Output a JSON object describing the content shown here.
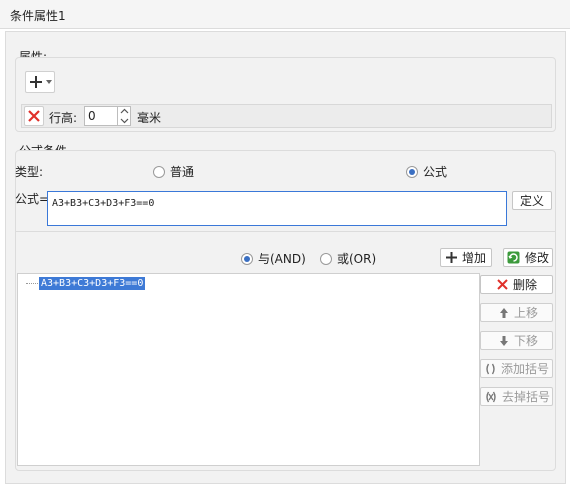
{
  "window": {
    "title": "条件属性1"
  },
  "properties": {
    "section_label": "属性:",
    "add_icon": "plus-icon",
    "row_height_label": "行高:",
    "row_height_value": "0",
    "row_height_unit": "毫米"
  },
  "formula_section": {
    "section_label": "公式条件",
    "type_label": "类型:",
    "type_options": [
      "普通",
      "公式"
    ],
    "type_selected": "公式",
    "formula_label": "公式=",
    "formula_value": "A3+B3+C3+D3+F3==0",
    "define_button": "定义",
    "logic_options": [
      "与(AND)",
      "或(OR)"
    ],
    "logic_selected": "与(AND)",
    "add_button": "增加",
    "modify_button": "修改",
    "condition_list": [
      "A3+B3+C3+D3+F3==0"
    ],
    "side_buttons": {
      "delete": "删除",
      "move_up": "上移",
      "move_down": "下移",
      "add_bracket": "添加括号",
      "remove_bracket": "去掉括号"
    }
  },
  "colors": {
    "accent_blue": "#3a78d8",
    "selection_bg": "#3e7ad6",
    "delete_red": "#e0302a",
    "modify_green": "#3c9a3c"
  }
}
